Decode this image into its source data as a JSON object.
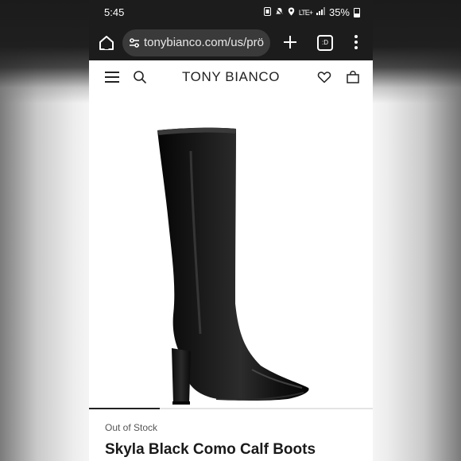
{
  "status_bar": {
    "time": "5:45",
    "network": "LTE+",
    "battery": "35%"
  },
  "browser": {
    "url": "tonybianco.com/us/prö",
    "tabs_count": ":D"
  },
  "site": {
    "brand": "TONY BIANCO"
  },
  "product": {
    "image_alt": "black leather knee-high boot",
    "gallery_progress": 0.25,
    "stock_status": "Out of Stock",
    "title": "Skyla Black Como Calf Boots"
  },
  "colors": {
    "browser_chrome": "#1c1c1c",
    "omnibox": "#3a3a3a",
    "page_bg": "#ffffff",
    "text_dark": "#1a1a1a"
  }
}
